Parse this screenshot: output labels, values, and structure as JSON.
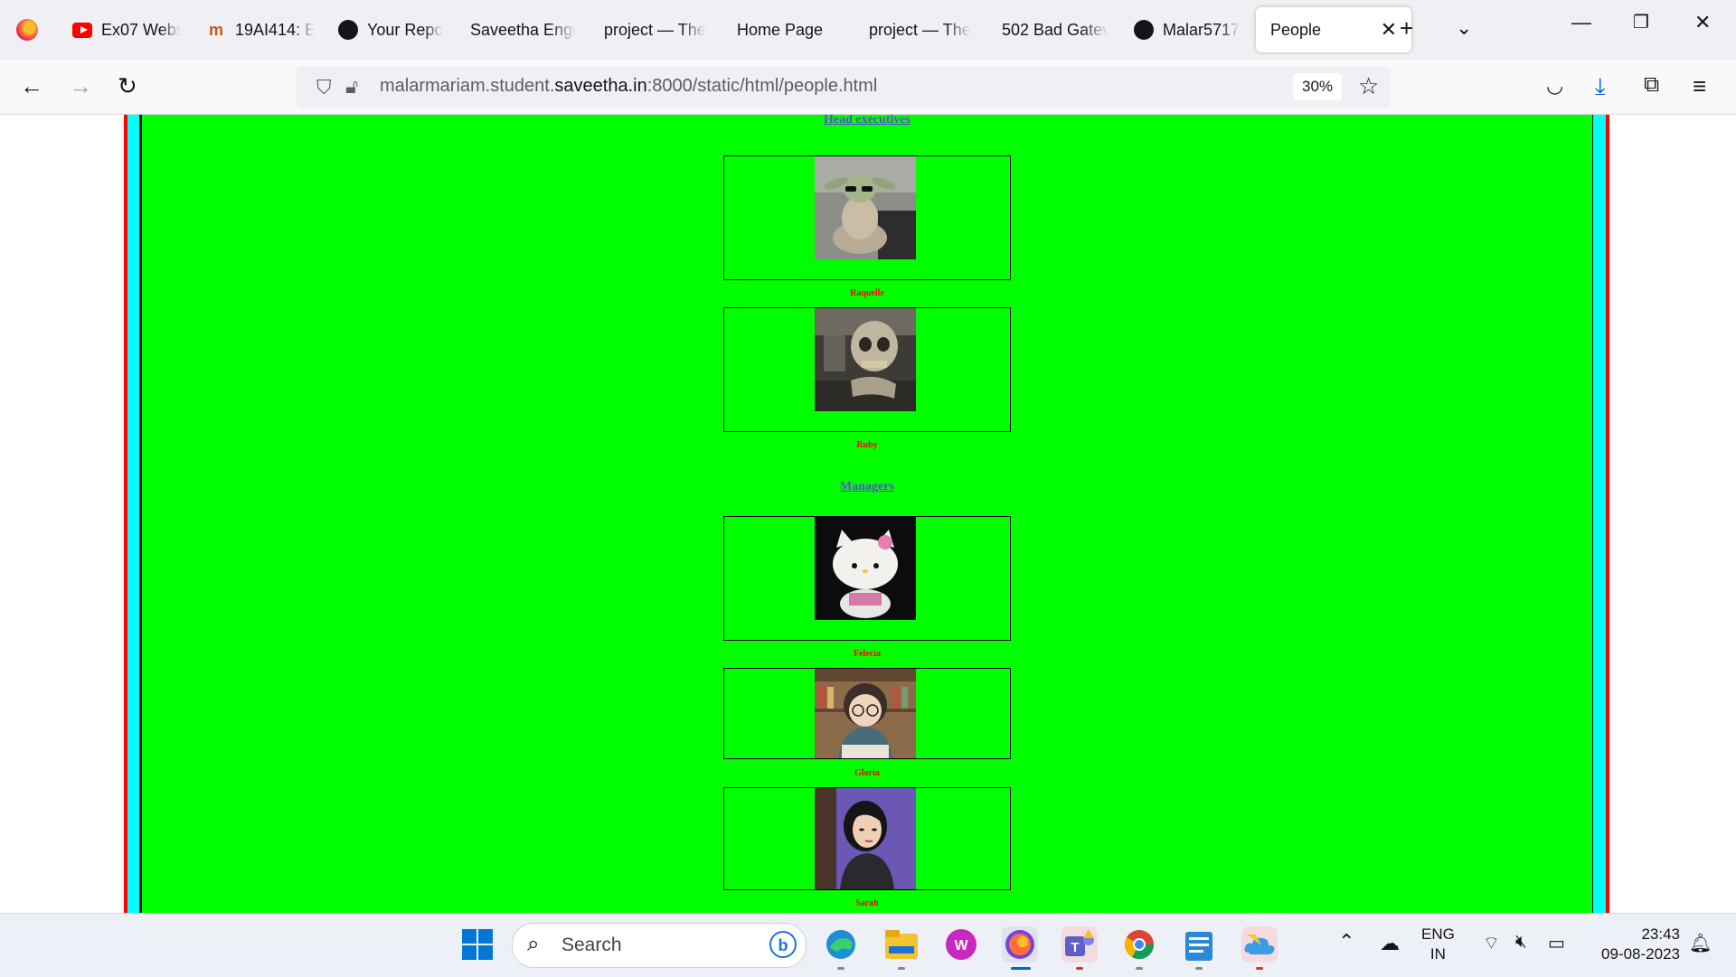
{
  "browser": {
    "tabs": [
      {
        "title": "Ex07 Webs",
        "icon": "youtube-icon"
      },
      {
        "title": "19AI414: E",
        "icon": "moodle-icon"
      },
      {
        "title": "Your Repo",
        "icon": "github-icon"
      },
      {
        "title": "Saveetha Engi",
        "icon": "none"
      },
      {
        "title": "project — The",
        "icon": "none"
      },
      {
        "title": "Home Page",
        "icon": "none"
      },
      {
        "title": "project — The",
        "icon": "none"
      },
      {
        "title": "502 Bad Gatev",
        "icon": "none"
      },
      {
        "title": "Malar5717",
        "icon": "github-icon"
      },
      {
        "title": "People",
        "icon": "none",
        "active": true
      }
    ],
    "url_prefix": "malarmariam.student.",
    "url_host": "saveetha.in",
    "url_suffix": ":8000/static/html/people.html",
    "zoom": "30%"
  },
  "page": {
    "colors": {
      "background": "#00ff00",
      "border_outer": "#ff0000",
      "border_inner": "#00ffff",
      "link": "#5b4dd6",
      "name": "#ff0000"
    },
    "sections": [
      {
        "heading": "Head executives",
        "people": [
          {
            "name": "Raquelle",
            "image": "baby-yoda-figure-photo"
          },
          {
            "name": "Ruby",
            "image": "skeleton-figure-photo"
          }
        ]
      },
      {
        "heading": "Managers",
        "people": [
          {
            "name": "Felecia",
            "image": "hello-kitty-plush-photo"
          },
          {
            "name": "Gloria",
            "image": "cartoon-girl-glasses-library"
          },
          {
            "name": "Sarah",
            "image": "cartoon-girl-purple-background"
          }
        ]
      }
    ]
  },
  "taskbar": {
    "search_placeholder": "Search",
    "apps": [
      "start-icon",
      "edge-icon",
      "file-explorer-icon",
      "wps-icon",
      "firefox-icon",
      "teams-icon",
      "chrome-icon",
      "notepad-icon",
      "onedrive-icon"
    ],
    "language": "ENG",
    "region": "IN",
    "time": "23:43",
    "date": "09-08-2023"
  }
}
